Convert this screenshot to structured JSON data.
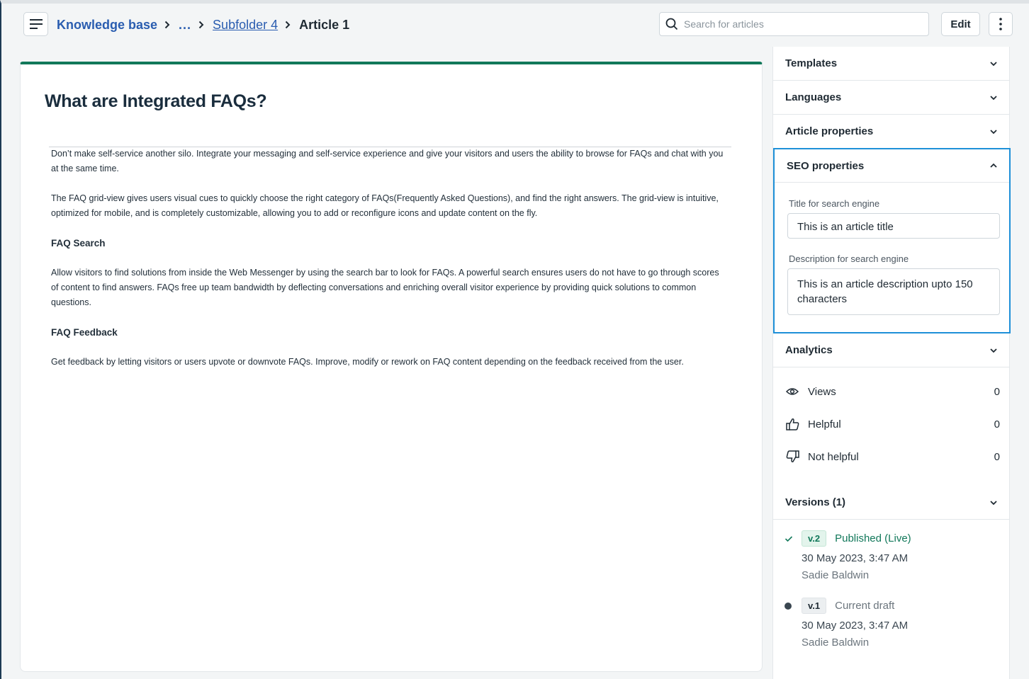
{
  "header": {
    "breadcrumb": {
      "root": "Knowledge base",
      "ellipsis": "...",
      "subfolder": "Subfolder 4",
      "current": "Article 1"
    },
    "search": {
      "placeholder": "Search for articles",
      "value": ""
    },
    "edit_label": "Edit"
  },
  "article": {
    "title": "What are Integrated FAQs?",
    "paragraphs": {
      "p1": "Don’t make self-service another silo. Integrate your messaging and self-service experience and give your visitors and users the ability to browse for FAQs and chat with you at the same time.",
      "p2": "The FAQ grid-view gives users visual cues to quickly choose the right category of FAQs(Frequently Asked Questions), and find the right answers. The grid-view is intuitive, optimized for mobile, and is completely customizable, allowing you to add or reconfigure icons and update content on the fly.",
      "h1": "FAQ Search",
      "p3": "Allow visitors to find solutions from inside the Web Messenger by using the search bar to look for FAQs. A powerful search ensures users do not have to go through scores of content to find answers. FAQs free up team bandwidth by deflecting conversations and enriching overall visitor experience by providing quick solutions to common questions.",
      "h2": "FAQ Feedback",
      "p4": "Get feedback by letting visitors or users upvote or downvote FAQs. Improve, modify or rework on FAQ content depending on the feedback received from the user."
    }
  },
  "sidebar": {
    "templates": "Templates",
    "languages": "Languages",
    "article_properties": "Article properties",
    "seo": {
      "title": "SEO properties",
      "title_label": "Title for search engine",
      "title_value": "This is an article title",
      "desc_label": "Description for search engine",
      "desc_value": "This is an article description upto 150 characters"
    },
    "analytics": {
      "title": "Analytics",
      "views_label": "Views",
      "views_value": "0",
      "helpful_label": "Helpful",
      "helpful_value": "0",
      "not_helpful_label": "Not helpful",
      "not_helpful_value": "0"
    },
    "versions": {
      "title": "Versions (1)",
      "v2": {
        "badge": "v.2",
        "status": "Published (Live)",
        "date": "30 May 2023, 3:47 AM",
        "author": "Sadie Baldwin"
      },
      "v1": {
        "badge": "v.1",
        "status": "Current draft",
        "date": "30 May 2023, 3:47 AM",
        "author": "Sadie Baldwin"
      }
    }
  },
  "colors": {
    "accent_green": "#11785a",
    "link_blue": "#2a5db0",
    "focus_blue": "#1e90d8"
  },
  "icons": [
    "menu-icon",
    "chevron-right-icon",
    "search-icon",
    "more-vertical-icon",
    "chevron-down-icon",
    "chevron-up-icon",
    "eye-icon",
    "thumbs-up-icon",
    "thumbs-down-icon",
    "check-icon",
    "dot-icon"
  ]
}
